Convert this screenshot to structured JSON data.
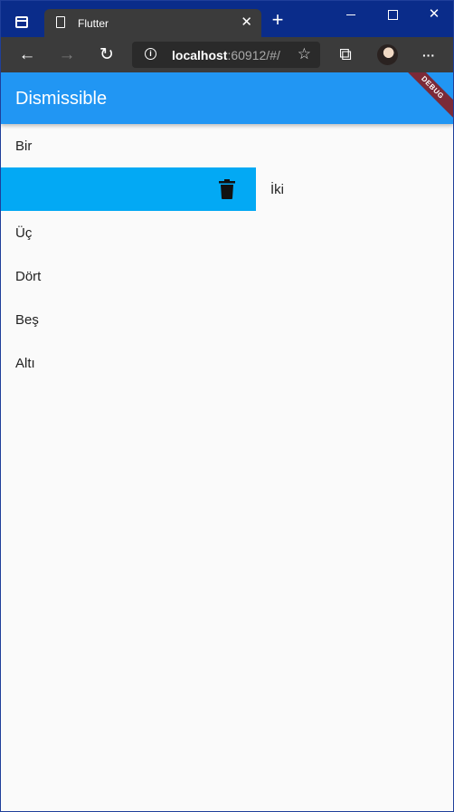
{
  "browser": {
    "tab": {
      "title": "Flutter",
      "close_glyph": "✕"
    },
    "new_tab_glyph": "+",
    "window_controls": {
      "close_glyph": "✕"
    },
    "toolbar": {
      "back_icon": "←",
      "forward_icon": "→",
      "reload_icon": "↻",
      "url_host": "localhost",
      "url_rest": ":60912/#/",
      "favorites_icon": "☆",
      "collections_icon": "⧉",
      "menu_icon": "···"
    }
  },
  "app": {
    "title": "Dismissible",
    "debug_banner": "DEBUG",
    "accent_color": "#2196f3",
    "dismiss_background_color": "#03a9f4",
    "items": [
      {
        "label": "Bir"
      },
      {
        "label": "İki",
        "swiping": true
      },
      {
        "label": "Üç"
      },
      {
        "label": "Dört"
      },
      {
        "label": "Beş"
      },
      {
        "label": "Altı"
      }
    ]
  }
}
